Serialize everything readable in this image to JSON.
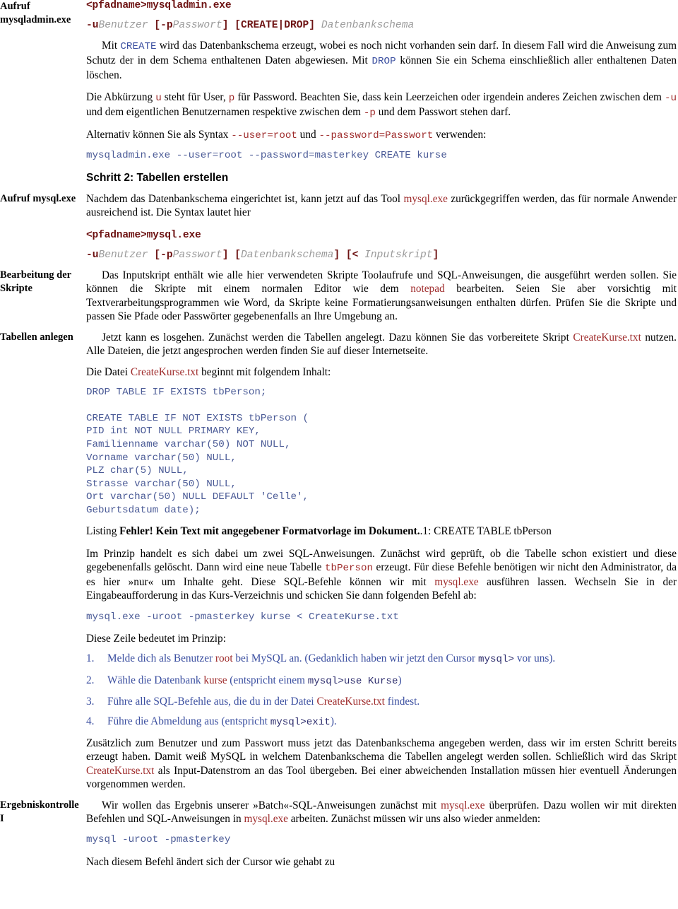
{
  "document": {
    "language": "de",
    "colors": {
      "keyword_blue": "#3b4fa0",
      "inline_maroon": "#9e2a2a",
      "syntax_dark_red": "#6d1212",
      "code_block_blue": "#4a5a96",
      "placeholder_gray": "#8a8a8a",
      "text_black": "#000000"
    }
  },
  "margin_notes": {
    "note1_line1": "Aufruf",
    "note1_line2": "mysqladmin.exe",
    "note2": "Aufruf mysql.exe",
    "note3_line1": "Bearbeitung der",
    "note3_line2": "Skripte",
    "note4": "Tabellen anlegen",
    "note5_line1": "Ergebniskontrolle",
    "note5_line2": "I"
  },
  "syntax_mysqladmin": {
    "path": "<pfadname>mysqladmin.exe",
    "flag_u": "-u",
    "arg_user": "Benutzer",
    "open_p": "[-p",
    "arg_pass": "Passwort",
    "close_p": "]",
    "create_drop": "[CREATE|DROP]",
    "arg_schema": "Datenbankschema"
  },
  "syntax_mysql": {
    "path": "<pfadname>mysql.exe",
    "flag_u": "-u",
    "arg_user": "Benutzer",
    "open_p": "[-p",
    "arg_pass": "Passwort",
    "close_p": "]",
    "open_schema": "[",
    "arg_schema": "Datenbankschema",
    "close_schema": "]",
    "open_input": "[<",
    "arg_input": "Inputskript",
    "close_input": "]"
  },
  "paragraphs": {
    "p_create_drop": {
      "t1": "Mit ",
      "kw1": "CREATE",
      "t2": " wird das Datenbankschema erzeugt, wobei es noch nicht vorhanden sein darf. In diesem Fall wird die Anweisung zum Schutz der in dem Schema enthaltenen Daten abgewiesen. Mit ",
      "kw2": "DROP",
      "t3": " können Sie ein Schema einschließlich aller enthaltenen Daten löschen."
    },
    "p_abkuerzung": {
      "t1": "Die Abkürzung ",
      "c1": "u",
      "t2": " steht für User, ",
      "c2": "p",
      "t3": " für Password. Beachten Sie, dass kein Leerzeichen oder irgendein anderes Zeichen zwischen dem ",
      "c3": "-u",
      "t4": " und dem eigentlichen Benutzernamen respektive zwischen dem ",
      "c4": "-p",
      "t5": " und dem Passwort stehen darf."
    },
    "p_alternativ": {
      "t1": "Alternativ können Sie als Syntax ",
      "c1": "--user=root",
      "t2": " und ",
      "c2": "--password=Passwort",
      "t3": " verwenden:"
    },
    "cmd_mysqladmin_create": "mysqladmin.exe --user=root --password=masterkey CREATE kurse",
    "heading_schritt2": "Schritt 2: Tabellen erstellen",
    "p_nachdem": {
      "t1": "Nachdem das Datenbankschema eingerichtet ist, kann jetzt auf das Tool ",
      "c1": "mysql.exe",
      "t2": " zurückgegriffen werden, das für normale Anwender ausreichend ist. Die Syntax lautet hier"
    },
    "p_inputskript": {
      "t1": "Das Inputskript enthält wie alle hier verwendeten Skripte Toolaufrufe und SQL-Anweisungen, die ausgeführt werden sollen. Sie können die Skripte mit einem normalen Editor wie dem ",
      "c1": "notepad",
      "t2": " bearbeiten. Seien Sie aber vorsichtig mit Textverarbeitungsprogrammen wie Word, da Skripte keine Formatierungsanweisungen enthalten dürfen. Prüfen Sie die Skripte und passen Sie Pfade oder Passwörter gegebenenfalls an Ihre Umgebung an."
    },
    "p_jetzt": {
      "t1": "Jetzt kann es losgehen. Zunächst werden die Tabellen angelegt. Dazu können Sie das vorbereitete Skript ",
      "c1": "CreateKurse.txt",
      "t2": " nutzen. Alle Dateien, die jetzt angesprochen werden finden Sie auf dieser Internetseite."
    },
    "p_datei": {
      "t1": "Die Datei ",
      "c1": "CreateKurse.txt",
      "t2": " beginnt mit folgendem Inhalt:"
    },
    "p_imprinzip": {
      "t1": "Im Prinzip handelt es sich dabei um zwei SQL-Anweisungen. Zunächst wird geprüft, ob die Tabelle schon existiert und diese gegebenenfalls gelöscht. Dann wird eine neue Tabelle ",
      "c1": "tbPerson",
      "t2": " erzeugt. Für diese Befehle benötigen wir nicht den Administrator, da es hier »nur« um Inhalte geht. Diese SQL-Befehle können wir mit ",
      "c2": "mysql.exe",
      "t3": " ausführen lassen. Wechseln Sie in der Eingabeaufforderung in das Kurs-Verzeichnis und schicken Sie dann folgenden Befehl ab:"
    },
    "cmd_mysql_create": "mysql.exe -uroot -pmasterkey kurse < CreateKurse.txt",
    "p_dieszeile": "Diese Zeile bedeutet im Prinzip:",
    "p_zusaetzlich": {
      "t1": "Zusätzlich zum Benutzer und zum Passwort muss jetzt das Datenbankschema angegeben werden, dass wir im ersten Schritt bereits erzeugt haben. Damit weiß MySQL in welchem Datenbankschema die Tabellen angelegt werden sollen. Schließlich wird das Skript ",
      "c1": "CreateKurse.txt",
      "t2": " als Input-Datenstrom an das Tool übergeben. Bei einer abweichenden Installation müssen hier eventuell Änderungen vorgenommen werden."
    },
    "p_wirwollen": {
      "t1": "Wir wollen das Ergebnis unserer »Batch«-SQL-Anweisungen zunächst mit ",
      "c1": "mysql.exe",
      "t2": " überprüfen. Dazu wollen wir mit direkten Befehlen und SQL-Anweisungen in ",
      "c2": "mysql.exe",
      "t3": " arbeiten. Zunächst müssen wir uns also wieder anmelden:"
    },
    "cmd_mysql_login": "mysql -uroot -pmasterkey",
    "p_nachdiesem": "Nach diesem Befehl ändert sich der Cursor wie gehabt zu"
  },
  "sql_block": "DROP TABLE IF EXISTS tbPerson;\n\nCREATE TABLE IF NOT EXISTS tbPerson (\nPID int NOT NULL PRIMARY KEY,\nFamilienname varchar(50) NOT NULL,\nVorname varchar(50) NULL,\nPLZ char(5) NULL,\nStrasse varchar(50) NULL,\nOrt varchar(50) NULL DEFAULT 'Celle',\nGeburtsdatum date);",
  "listing_caption": {
    "t1": "Listing ",
    "bold": "Fehler! Kein Text mit angegebener Formatvorlage im Dokument.",
    "t2": ".1: CREATE TABLE tbPerson"
  },
  "steps_list": {
    "item1": {
      "t1": "Melde dich als Benutzer ",
      "c1": "root",
      "t2": " bei MySQL an. (Gedanklich haben wir jetzt den Cursor ",
      "c2": "mysql>",
      "t3": " vor uns)."
    },
    "item2": {
      "t1": "Wähle die Datenbank ",
      "c1": "kurse",
      "t2": " (entspricht einem ",
      "c2": "mysql>use Kurse",
      "t3": ")"
    },
    "item3": {
      "t1": "Führe alle SQL-Befehle aus, die du in der Datei ",
      "c1": "CreateKurse.txt",
      "t2": " findest."
    },
    "item4": {
      "t1": "Führe die Abmeldung aus (entspricht ",
      "c1": "mysql>exit",
      "t2": ")."
    }
  }
}
